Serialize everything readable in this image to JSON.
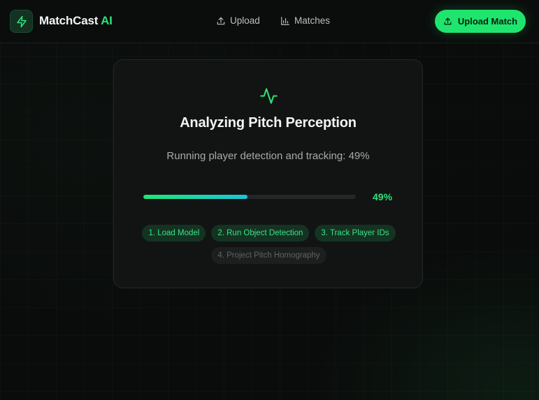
{
  "header": {
    "brand_name": "MatchCast",
    "brand_suffix": "AI",
    "logo_icon": "lightning-bolt-icon",
    "nav": [
      {
        "label": "Upload",
        "icon": "upload-icon"
      },
      {
        "label": "Matches",
        "icon": "bar-chart-icon"
      }
    ],
    "cta_label": "Upload Match",
    "cta_icon": "upload-icon"
  },
  "card": {
    "icon": "activity-pulse-icon",
    "title": "Analyzing Pitch Perception",
    "status": "Running player detection and tracking: 49%",
    "progress": 0.49,
    "progress_label": "49%",
    "steps": [
      {
        "label": "1. Load Model",
        "state": "done"
      },
      {
        "label": "2. Run Object Detection",
        "state": "done"
      },
      {
        "label": "3. Track Player IDs",
        "state": "done"
      },
      {
        "label": "4. Project Pitch Homography",
        "state": "pending"
      }
    ]
  },
  "colors": {
    "accent": "#1fe56f",
    "background": "#0a0c0b",
    "card": "#121413",
    "progress_start": "#20e57a",
    "progress_end": "#1cc4d8"
  }
}
